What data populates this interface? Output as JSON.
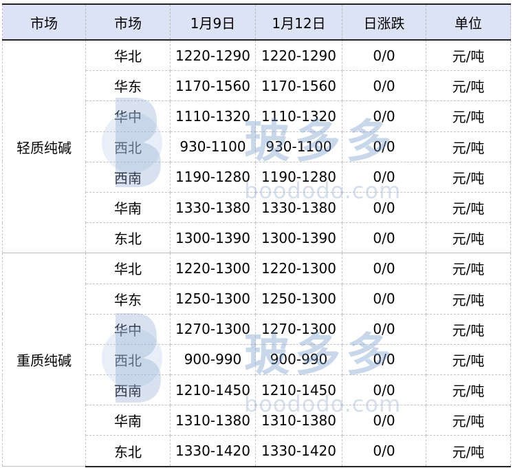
{
  "headers": [
    "市场",
    "市场",
    "1月9日",
    "1月12日",
    "日涨跌",
    "单位"
  ],
  "groups": [
    {
      "name": "轻质纯碱",
      "rows": [
        {
          "region": "华北",
          "jan9": "1220-1290",
          "jan12": "1220-1290",
          "change": "0/0",
          "unit": "元/吨"
        },
        {
          "region": "华东",
          "jan9": "1170-1560",
          "jan12": "1170-1560",
          "change": "0/0",
          "unit": "元/吨"
        },
        {
          "region": "华中",
          "jan9": "1110-1320",
          "jan12": "1110-1320",
          "change": "0/0",
          "unit": "元/吨"
        },
        {
          "region": "西北",
          "jan9": "930-1100",
          "jan12": "930-1100",
          "change": "0/0",
          "unit": "元/吨"
        },
        {
          "region": "西南",
          "jan9": "1190-1280",
          "jan12": "1190-1280",
          "change": "0/0",
          "unit": "元/吨"
        },
        {
          "region": "华南",
          "jan9": "1330-1380",
          "jan12": "1330-1380",
          "change": "0/0",
          "unit": "元/吨"
        },
        {
          "region": "东北",
          "jan9": "1300-1390",
          "jan12": "1300-1390",
          "change": "0/0",
          "unit": "元/吨"
        }
      ]
    },
    {
      "name": "重质纯碱",
      "rows": [
        {
          "region": "华北",
          "jan9": "1220-1300",
          "jan12": "1220-1300",
          "change": "0/0",
          "unit": "元/吨"
        },
        {
          "region": "华东",
          "jan9": "1250-1300",
          "jan12": "1250-1300",
          "change": "0/0",
          "unit": "元/吨"
        },
        {
          "region": "华中",
          "jan9": "1270-1300",
          "jan12": "1270-1300",
          "change": "0/0",
          "unit": "元/吨"
        },
        {
          "region": "西北",
          "jan9": "900-990",
          "jan12": "900-990",
          "change": "0/0",
          "unit": "元/吨"
        },
        {
          "region": "西南",
          "jan9": "1210-1450",
          "jan12": "1210-1450",
          "change": "0/0",
          "unit": "元/吨"
        },
        {
          "region": "华南",
          "jan9": "1310-1380",
          "jan12": "1310-1380",
          "change": "0/0",
          "unit": "元/吨"
        },
        {
          "region": "东北",
          "jan9": "1330-1420",
          "jan12": "1330-1420",
          "change": "0/0",
          "unit": "元/吨"
        }
      ]
    }
  ],
  "watermark": {
    "brand_text": "玻多多",
    "url_text": "boododo.com",
    "color": "#8aa9cf"
  }
}
